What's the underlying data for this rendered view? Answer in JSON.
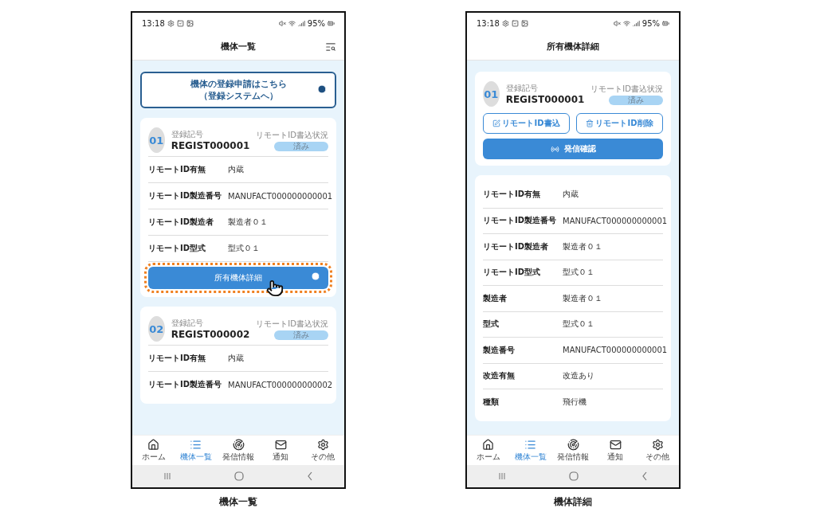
{
  "screens": [
    {
      "kind": "list",
      "caption": "機体一覧",
      "status_bar": {
        "time": "13:18",
        "battery": "95%"
      },
      "title": "機体一覧",
      "banner": {
        "lines": [
          "機体の登録申請はこちら",
          "（登録システムへ）"
        ]
      },
      "cards": [
        {
          "number": "01",
          "reg_label": "登録記号",
          "reg_no": "REGIST000001",
          "status_label": "リモートID書込状況",
          "status": "済み",
          "rows": [
            {
              "label": "リモートID有無",
              "value": "内蔵"
            },
            {
              "label": "リモートID製造番号",
              "value": "MANUFACT000000000001"
            },
            {
              "label": "リモートID製造者",
              "value": "製造者０１"
            },
            {
              "label": "リモートID型式",
              "value": "型式０１"
            }
          ],
          "button": {
            "label": "所有機体詳細",
            "highlighted": true
          }
        },
        {
          "number": "02",
          "reg_label": "登録記号",
          "reg_no": "REGIST000002",
          "status_label": "リモートID書込状況",
          "status": "済み",
          "rows": [
            {
              "label": "リモートID有無",
              "value": "内蔵"
            },
            {
              "label": "リモートID製造番号",
              "value": "MANUFACT000000000002"
            }
          ]
        }
      ],
      "nav": [
        {
          "label": "ホーム",
          "selected": false
        },
        {
          "label": "機体一覧",
          "selected": true
        },
        {
          "label": "発信情報",
          "selected": false
        },
        {
          "label": "通知",
          "selected": false
        },
        {
          "label": "その他",
          "selected": false
        }
      ]
    },
    {
      "kind": "detail",
      "caption": "機体詳細",
      "status_bar": {
        "time": "13:18",
        "battery": "95%"
      },
      "title": "所有機体詳細",
      "card": {
        "number": "01",
        "reg_label": "登録記号",
        "reg_no": "REGIST000001",
        "status_label": "リモートID書込状況",
        "status": "済み",
        "actions": [
          {
            "kind": "write",
            "label": "リモートID書込"
          },
          {
            "kind": "delete",
            "label": "リモートID削除"
          }
        ],
        "primary": {
          "label": "発信確認"
        }
      },
      "rows": [
        {
          "label": "リモートID有無",
          "value": "内蔵"
        },
        {
          "label": "リモートID製造番号",
          "value": "MANUFACT000000000001"
        },
        {
          "label": "リモートID製造者",
          "value": "製造者０１"
        },
        {
          "label": "リモートID型式",
          "value": "型式０１"
        },
        {
          "label": "製造者",
          "value": "製造者０１"
        },
        {
          "label": "型式",
          "value": "型式０１"
        },
        {
          "label": "製造番号",
          "value": "MANUFACT000000000001"
        },
        {
          "label": "改造有無",
          "value": "改造あり"
        },
        {
          "label": "種類",
          "value": "飛行機"
        }
      ],
      "nav": [
        {
          "label": "ホーム",
          "selected": false
        },
        {
          "label": "機体一覧",
          "selected": true
        },
        {
          "label": "発信情報",
          "selected": false
        },
        {
          "label": "通知",
          "selected": false
        },
        {
          "label": "その他",
          "selected": false
        }
      ]
    }
  ]
}
